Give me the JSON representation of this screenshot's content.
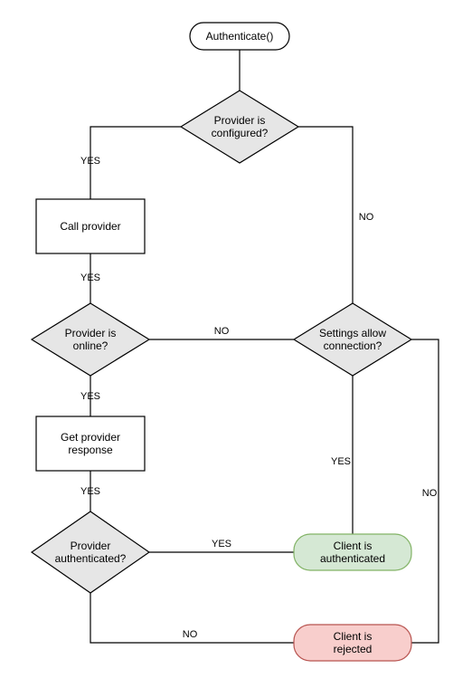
{
  "chart_data": {
    "type": "flowchart",
    "title": "",
    "nodes": [
      {
        "id": "start",
        "shape": "terminator",
        "label": "Authenticate()"
      },
      {
        "id": "d_configured",
        "shape": "decision",
        "label": "Provider is configured?"
      },
      {
        "id": "p_call",
        "shape": "process",
        "label": "Call provider"
      },
      {
        "id": "d_online",
        "shape": "decision",
        "label": "Provider is online?"
      },
      {
        "id": "p_getresp",
        "shape": "process",
        "label": "Get provider response"
      },
      {
        "id": "d_auth",
        "shape": "decision",
        "label": "Provider authenticated?"
      },
      {
        "id": "d_settings",
        "shape": "decision",
        "label": "Settings allow connection?"
      },
      {
        "id": "t_ok",
        "shape": "terminator",
        "label": "Client is authenticated",
        "fill": "#d5e8d4",
        "stroke": "#82b366"
      },
      {
        "id": "t_rej",
        "shape": "terminator",
        "label": "Client is rejected",
        "fill": "#f8cecc",
        "stroke": "#b85450"
      }
    ],
    "edges": [
      {
        "from": "start",
        "to": "d_configured",
        "label": ""
      },
      {
        "from": "d_configured",
        "to": "p_call",
        "label": "YES"
      },
      {
        "from": "d_configured",
        "to": "d_settings",
        "label": "NO"
      },
      {
        "from": "p_call",
        "to": "d_online",
        "label": "YES"
      },
      {
        "from": "d_online",
        "to": "p_getresp",
        "label": "YES"
      },
      {
        "from": "d_online",
        "to": "d_settings",
        "label": "NO"
      },
      {
        "from": "p_getresp",
        "to": "d_auth",
        "label": "YES"
      },
      {
        "from": "d_auth",
        "to": "t_ok",
        "label": "YES"
      },
      {
        "from": "d_auth",
        "to": "t_rej",
        "label": "NO"
      },
      {
        "from": "d_settings",
        "to": "t_ok",
        "label": "YES"
      },
      {
        "from": "d_settings",
        "to": "t_rej",
        "label": "NO"
      }
    ]
  },
  "labels": {
    "start": "Authenticate()",
    "d_configured_l1": "Provider is",
    "d_configured_l2": "configured?",
    "p_call": "Call provider",
    "d_online_l1": "Provider is",
    "d_online_l2": "online?",
    "p_getresp_l1": "Get provider",
    "p_getresp_l2": "response",
    "d_auth_l1": "Provider",
    "d_auth_l2": "authenticated?",
    "d_settings_l1": "Settings allow",
    "d_settings_l2": "connection?",
    "t_ok_l1": "Client is",
    "t_ok_l2": "authenticated",
    "t_rej_l1": "Client is",
    "t_rej_l2": "rejected"
  },
  "edge_labels": {
    "yes": "YES",
    "no": "NO"
  }
}
